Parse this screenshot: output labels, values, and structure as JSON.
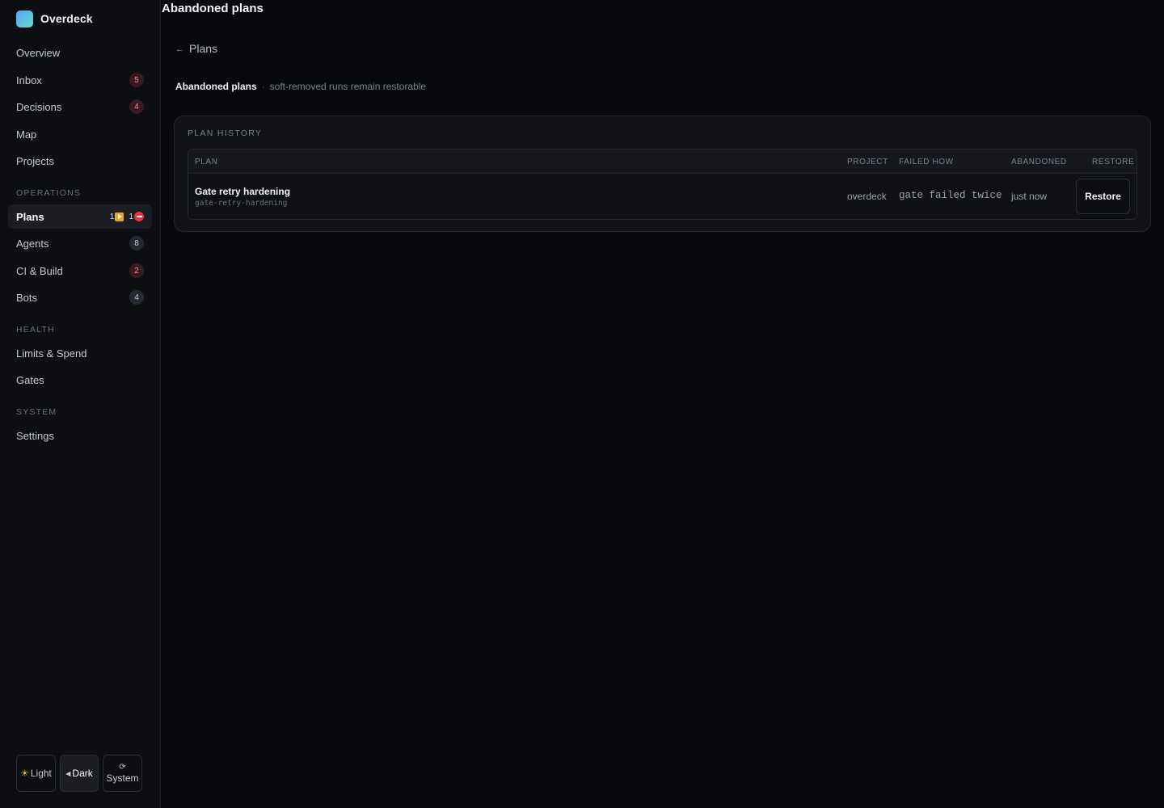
{
  "app": {
    "name": "Overdeck"
  },
  "sidebar": {
    "items": [
      {
        "label": "Overview"
      },
      {
        "label": "Inbox",
        "badge": "5"
      },
      {
        "label": "Decisions",
        "badge": "4"
      },
      {
        "label": "Map"
      },
      {
        "label": "Projects"
      }
    ],
    "sections": {
      "operations": {
        "label": "OPERATIONS",
        "items": [
          {
            "label": "Plans",
            "running": "1",
            "blocked": "1",
            "active": true
          },
          {
            "label": "Agents",
            "badge": "8"
          },
          {
            "label": "CI & Build",
            "badge": "2"
          },
          {
            "label": "Bots",
            "badge": "4"
          }
        ]
      },
      "health": {
        "label": "HEALTH",
        "items": [
          {
            "label": "Limits & Spend"
          },
          {
            "label": "Gates"
          }
        ]
      },
      "system": {
        "label": "SYSTEM",
        "items": [
          {
            "label": "Settings"
          }
        ]
      }
    },
    "theme": {
      "options": [
        {
          "label": "Light",
          "icon": "sun-icon"
        },
        {
          "label": "Dark",
          "icon": "moon-icon",
          "selected": true
        },
        {
          "label": "System",
          "icon": "system-icon"
        }
      ]
    }
  },
  "page": {
    "title": "Abandoned plans",
    "back_link": "Plans",
    "subheading": {
      "title": "Abandoned plans",
      "separator": "·",
      "note": "soft-removed runs remain restorable"
    }
  },
  "history": {
    "title": "PLAN HISTORY",
    "columns": {
      "plan": "PLAN",
      "project": "PROJECT",
      "failed_how": "FAILED HOW",
      "abandoned": "ABANDONED",
      "restore": "RESTORE"
    },
    "rows": [
      {
        "name": "Gate retry hardening",
        "slug": "gate-retry-hardening",
        "project": "overdeck",
        "failed_how": "gate failed twice",
        "abandoned": "just now",
        "action": "Restore"
      }
    ]
  },
  "colors": {
    "background": "#08090c",
    "sidebar": "#0d0e12",
    "accent_running": "#f0a020",
    "accent_blocked": "#e5333f",
    "badge_alert": "#f08a99"
  }
}
